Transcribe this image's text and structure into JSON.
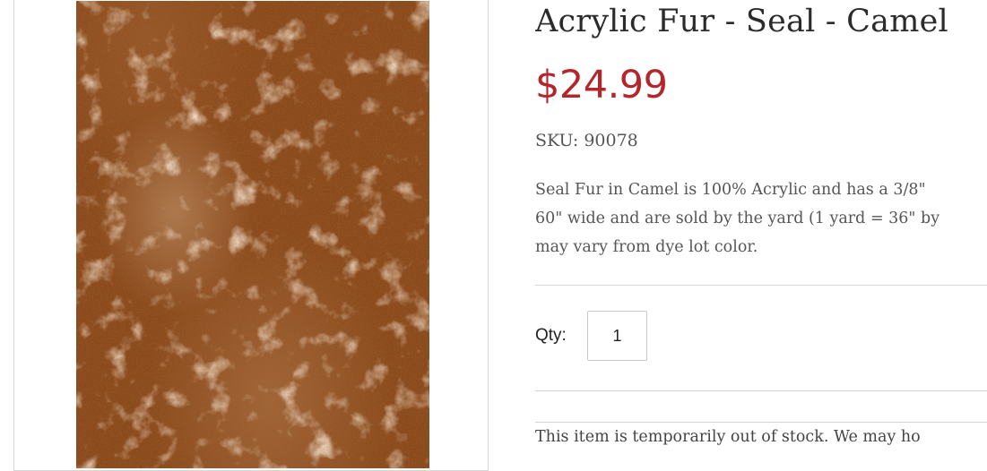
{
  "product": {
    "title": "Acrylic Fur - Seal - Camel",
    "price": "$24.99",
    "sku_label": "SKU:",
    "sku_value": "90078",
    "description_lines": [
      "Seal Fur in Camel is 100% Acrylic and has a 3/8\"",
      "60\" wide and are sold by the yard (1 yard = 36\" by",
      "may vary from dye lot color."
    ],
    "image": {
      "alt": "Camel seal fur swatch",
      "base_color": "#8b4a1c"
    }
  },
  "purchase": {
    "qty_label": "Qty:",
    "qty_value": "1"
  },
  "stock_message": "This item is temporarily out of stock. We may ho",
  "colors": {
    "price": "#b3262b",
    "title": "#2b2b2b",
    "body_text": "#555555",
    "divider": "#d4d4d4"
  }
}
